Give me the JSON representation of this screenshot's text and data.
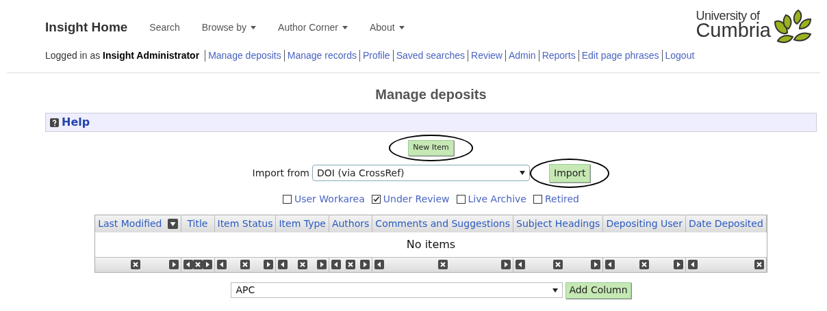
{
  "brand": "Insight Home",
  "nav": [
    {
      "label": "Search",
      "dropdown": false
    },
    {
      "label": "Browse by",
      "dropdown": true
    },
    {
      "label": "Author Corner",
      "dropdown": true
    },
    {
      "label": "About",
      "dropdown": true
    }
  ],
  "logo": {
    "line_1": "University of",
    "line_2": "Cumbria"
  },
  "login": {
    "prefix": "Logged in as",
    "user": "Insight Administrator"
  },
  "user_links": [
    "Manage deposits",
    "Manage records",
    "Profile",
    "Saved searches",
    "Review",
    "Admin",
    "Reports",
    "Edit page phrases",
    "Logout"
  ],
  "page_title": "Manage deposits",
  "help": {
    "label": "Help"
  },
  "new_item": {
    "label": "New Item",
    "circled": true
  },
  "import": {
    "label": "Import from",
    "value": "DOI (via CrossRef)",
    "button": "Import",
    "circled": true
  },
  "filters": [
    {
      "label": "User Workarea",
      "checked": false
    },
    {
      "label": "Under Review",
      "checked": true
    },
    {
      "label": "Live Archive",
      "checked": false
    },
    {
      "label": "Retired",
      "checked": false
    }
  ],
  "table": {
    "columns": [
      {
        "label": "Last Modified",
        "sorted": true,
        "controls": [
          {
            "kind": "remove"
          },
          {
            "kind": "right"
          }
        ]
      },
      {
        "label": "Title",
        "sorted": false,
        "controls": [
          {
            "kind": "left"
          },
          {
            "kind": "remove"
          },
          {
            "kind": "right"
          }
        ]
      },
      {
        "label": "Item Status",
        "sorted": false,
        "controls": [
          {
            "kind": "left"
          },
          {
            "kind": "remove"
          },
          {
            "kind": "right"
          }
        ]
      },
      {
        "label": "Item Type",
        "sorted": false,
        "controls": [
          {
            "kind": "left"
          },
          {
            "kind": "remove"
          },
          {
            "kind": "right"
          }
        ]
      },
      {
        "label": "Authors",
        "sorted": false,
        "controls": [
          {
            "kind": "left"
          },
          {
            "kind": "remove"
          },
          {
            "kind": "right"
          }
        ]
      },
      {
        "label": "Comments and Suggestions",
        "sorted": false,
        "controls": [
          {
            "kind": "left"
          },
          {
            "kind": "remove"
          },
          {
            "kind": "right"
          }
        ]
      },
      {
        "label": "Subject Headings",
        "sorted": false,
        "controls": [
          {
            "kind": "left"
          },
          {
            "kind": "remove"
          },
          {
            "kind": "right"
          }
        ]
      },
      {
        "label": "Depositing User",
        "sorted": false,
        "controls": [
          {
            "kind": "left"
          },
          {
            "kind": "remove"
          },
          {
            "kind": "right"
          }
        ]
      },
      {
        "label": "Date Deposited",
        "sorted": false,
        "controls": [
          {
            "kind": "left"
          },
          {
            "kind": "remove"
          }
        ]
      }
    ],
    "empty_message": "No items"
  },
  "add_column": {
    "value": "APC",
    "button": "Add Column"
  }
}
